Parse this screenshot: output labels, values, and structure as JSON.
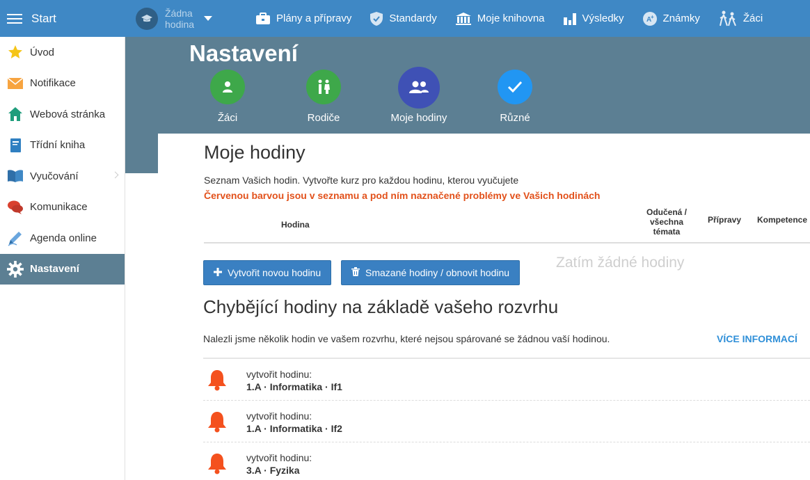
{
  "topbar": {
    "start_label": "Start",
    "class_select": {
      "line1": "Žádna",
      "line2": "hodina"
    },
    "nav": [
      {
        "label": "Plány a přípravy",
        "icon": "briefcase-icon"
      },
      {
        "label": "Standardy",
        "icon": "shield-check-icon"
      },
      {
        "label": "Moje knihovna",
        "icon": "library-icon"
      },
      {
        "label": "Výsledky",
        "icon": "bar-chart-icon"
      },
      {
        "label": "Známky",
        "icon": "grade-icon"
      },
      {
        "label": "Žáci",
        "icon": "students-walking-icon"
      }
    ]
  },
  "sidebar": {
    "items": [
      {
        "label": "Úvod",
        "icon": "star-icon"
      },
      {
        "label": "Notifikace",
        "icon": "envelope-icon"
      },
      {
        "label": "Webová stránka",
        "icon": "house-icon"
      },
      {
        "label": "Třídní kniha",
        "icon": "notebook-icon"
      },
      {
        "label": "Vyučování",
        "icon": "open-book-icon"
      },
      {
        "label": "Komunikace",
        "icon": "chat-icon"
      },
      {
        "label": "Agenda online",
        "icon": "pen-icon"
      },
      {
        "label": "Nastavení",
        "icon": "gear-icon"
      }
    ]
  },
  "header": {
    "title": "Nastavení",
    "tabs": [
      {
        "label": "Žáci",
        "icon": "person-icon",
        "color": "#3ea84a"
      },
      {
        "label": "Rodiče",
        "icon": "parents-icon",
        "color": "#3ea84a"
      },
      {
        "label": "Moje hodiny",
        "icon": "group-icon",
        "color": "#3f51b5"
      },
      {
        "label": "Různé",
        "icon": "check-icon",
        "color": "#2196f3"
      }
    ]
  },
  "lessons": {
    "heading": "Moje hodiny",
    "description": "Seznam Vašich hodin. Vytvořte kurz pro každou hodinu, kterou vyučujete",
    "warning": "Červenou barvou jsou v seznamu a pod ním naznačené problémy ve Vašich hodinách",
    "columns": {
      "hodina": "Hodina",
      "topics_1": "Odučená /",
      "topics_2": "všechna",
      "topics_3": "témata",
      "pripravy": "Přípravy",
      "kompetence": "Kompetence"
    },
    "create_button": "Vytvořit novou hodinu",
    "deleted_button": "Smazané hodiny / obnovit hodinu",
    "empty_text": "Zatím žádné hodiny"
  },
  "missing": {
    "heading": "Chybějící hodiny na základě vašeho rozvrhu",
    "description": "Nalezli jsme několik hodin ve vašem rozvrhu, které nejsou spárované se žádnou vaší hodinou.",
    "more_link": "VÍCE INFORMACÍ",
    "rows": [
      {
        "prefix": "vytvořit hodinu:",
        "name": "1.A · Informatika · If1"
      },
      {
        "prefix": "vytvořit hodinu:",
        "name": "1.A · Informatika · If2"
      },
      {
        "prefix": "vytvořit hodinu:",
        "name": "3.A · Fyzika"
      }
    ]
  },
  "colors": {
    "topbar": "#3f88c5",
    "header_band": "#5c7f93",
    "warning": "#e2511b",
    "bell": "#f4511e",
    "button": "#3a80c2",
    "link": "#2f8fd8"
  }
}
